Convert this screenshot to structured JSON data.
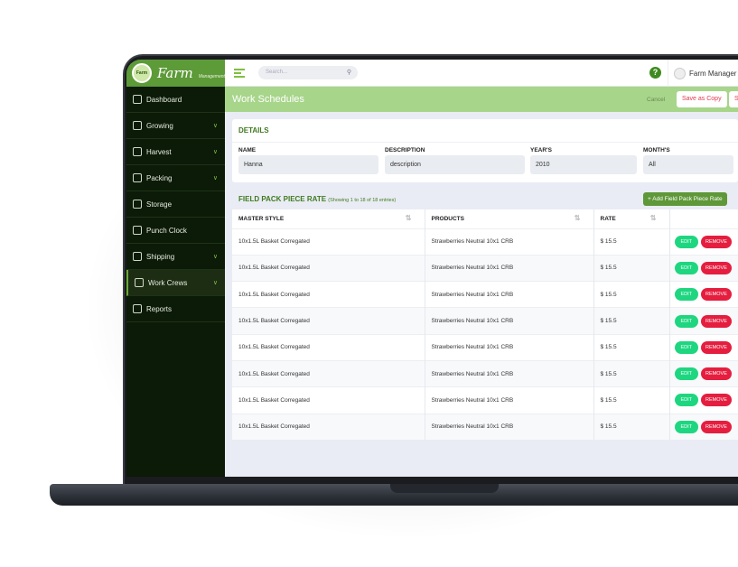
{
  "colors": {
    "sidebar": "#0c1a08",
    "brand": "#5d9a38",
    "titlebar": "#a7d58a",
    "edit": "#1ed67f",
    "remove": "#e51e3f"
  },
  "logo": {
    "text": "Farm",
    "sub": "Management",
    "badge": "Farm"
  },
  "sidebar": {
    "items": [
      {
        "label": "Dashboard",
        "icon": "monitor-icon",
        "chevron": false
      },
      {
        "label": "Growing",
        "icon": "sprout-icon",
        "chevron": true
      },
      {
        "label": "Harvest",
        "icon": "sickle-icon",
        "chevron": true
      },
      {
        "label": "Packing",
        "icon": "box-icon",
        "chevron": true
      },
      {
        "label": "Storage",
        "icon": "warehouse-icon",
        "chevron": false
      },
      {
        "label": "Punch Clock",
        "icon": "clock-icon",
        "chevron": false
      },
      {
        "label": "Shipping",
        "icon": "truck-icon",
        "chevron": true
      },
      {
        "label": "Work Crews",
        "icon": "people-icon",
        "chevron": true,
        "active": true
      },
      {
        "label": "Reports",
        "icon": "report-icon",
        "chevron": false
      }
    ]
  },
  "topbar": {
    "search_placeholder": "Search...",
    "user": "Farm Manager",
    "help": "?"
  },
  "page": {
    "title": "Work Schedules",
    "cancel": "Cancel",
    "save_copy": "Save as Copy",
    "save": "Save"
  },
  "details": {
    "title": "DETAILS",
    "fields": [
      {
        "label": "NAME",
        "value": "Hanna"
      },
      {
        "label": "DESCRIPTION",
        "value": "description"
      },
      {
        "label": "YEAR'S",
        "value": "2010"
      },
      {
        "label": "MONTH'S",
        "value": "All"
      }
    ]
  },
  "rates": {
    "title": "FIELD PACK PIECE RATE",
    "info": "(Showing 1 to 18 of 18 entries)",
    "add": "+ Add Field Pack Piece Rate",
    "columns": [
      "MASTER STYLE",
      "PRODUCTS",
      "RATE"
    ],
    "edit": "EDIT",
    "remove": "REMOVE",
    "rows": [
      [
        "10x1.5L Basket Corregated",
        "Strawberries Neutral 10x1 CRB",
        "$ 15.5"
      ],
      [
        "10x1.5L Basket Corregated",
        "Strawberries Neutral 10x1 CRB",
        "$ 15.5"
      ],
      [
        "10x1.5L Basket Corregated",
        "Strawberries Neutral 10x1 CRB",
        "$ 15.5"
      ],
      [
        "10x1.5L Basket Corregated",
        "Strawberries Neutral 10x1 CRB",
        "$ 15.5"
      ],
      [
        "10x1.5L Basket Corregated",
        "Strawberries Neutral 10x1 CRB",
        "$ 15.5"
      ],
      [
        "10x1.5L Basket Corregated",
        "Strawberries Neutral 10x1 CRB",
        "$ 15.5"
      ],
      [
        "10x1.5L Basket Corregated",
        "Strawberries Neutral 10x1 CRB",
        "$ 15.5"
      ],
      [
        "10x1.5L Basket Corregated",
        "Strawberries Neutral 10x1 CRB",
        "$ 15.5"
      ]
    ]
  }
}
